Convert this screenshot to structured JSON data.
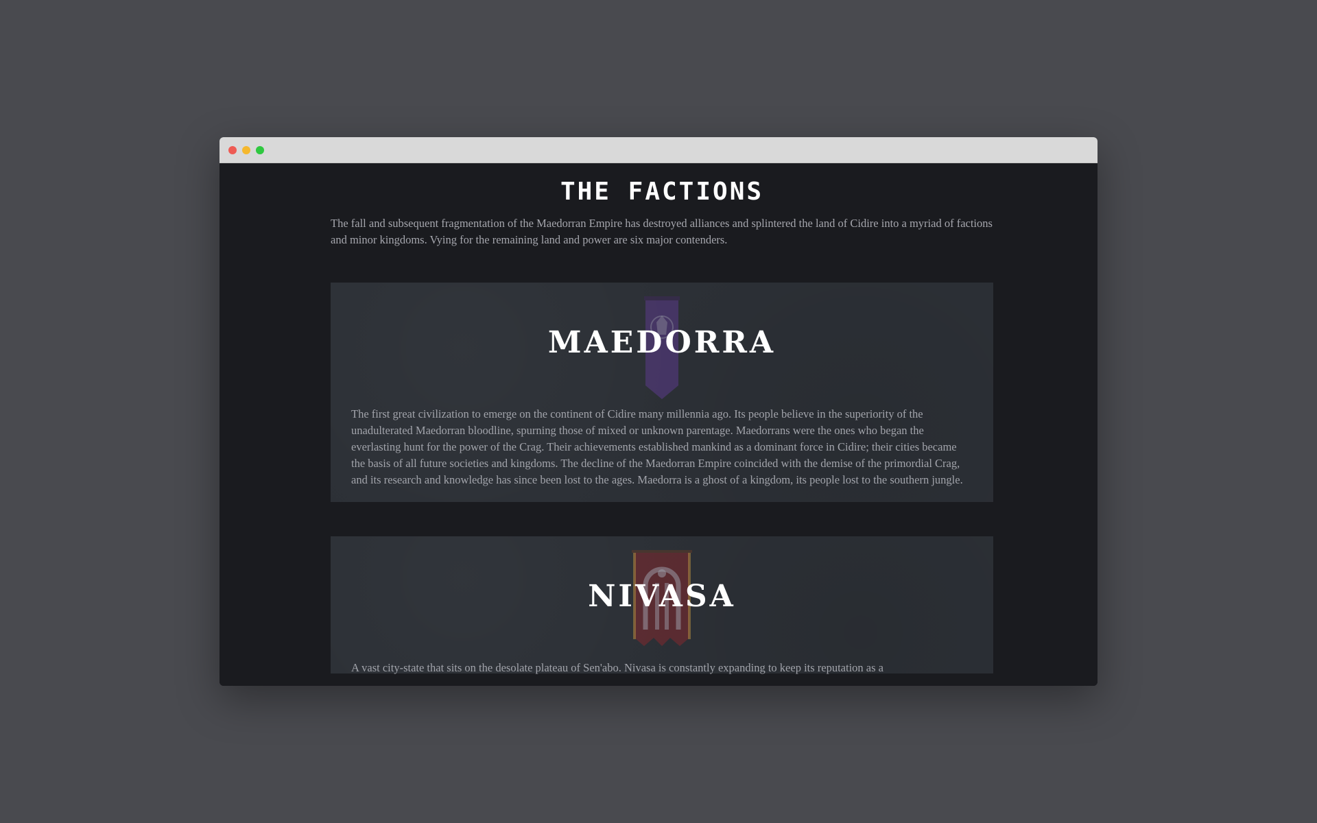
{
  "window": {
    "controls": [
      "close",
      "minimize",
      "maximize"
    ]
  },
  "page": {
    "title": "The Factions",
    "intro": "The fall and subsequent fragmentation of the Maedorran Empire has destroyed alliances and splintered the land of Cidire into a myriad of factions and minor kingdoms. Vying for the remaining land and power are six major contenders."
  },
  "factions": [
    {
      "name": "Maedorra",
      "banner_color": "#5b3a8a",
      "banner_icon": "crest-emblem-icon",
      "description": "The first great civilization to emerge on the continent of Cidire many millennia ago. Its people believe in the superiority of the unadulterated Maedorran bloodline, spurning those of mixed or unknown parentage. Maedorrans were the ones who began the everlasting hunt for the power of the Crag. Their achievements established mankind as a dominant force in Cidire; their cities became the basis of all future societies and kingdoms. The decline of the Maedorran Empire coincided with the demise of the primordial Crag, and its research and knowledge has since been lost to the ages. Maedorra is a ghost of a kingdom, its people lost to the southern jungle."
    },
    {
      "name": "Nivasa",
      "banner_color": "#7a2a2e",
      "banner_icon": "arch-gate-icon",
      "description": "A vast city-state that sits on the desolate plateau of Sen'abo. Nivasa is constantly expanding to keep its reputation as a"
    }
  ]
}
